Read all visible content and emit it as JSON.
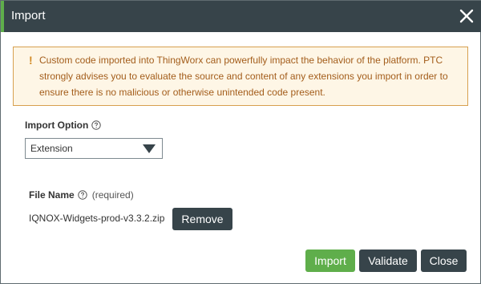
{
  "dialog": {
    "title": "Import",
    "close_icon": "close-x-icon"
  },
  "warning": {
    "icon": "!",
    "text": "Custom code imported into ThingWorx can powerfully impact the behavior of the platform. PTC strongly advises you to evaluate the source and content of any extensions you import in order to ensure there is no malicious or otherwise unintended code present."
  },
  "import_option": {
    "label": "Import Option",
    "selected": "Extension"
  },
  "file_name": {
    "label": "File Name",
    "required": "(required)",
    "value": "IQNOX-Widgets-prod-v3.3.2.zip"
  },
  "buttons": {
    "remove": "Remove",
    "import": "Import",
    "validate": "Validate",
    "close": "Close"
  },
  "colors": {
    "header_bg": "#37444a",
    "accent_green": "#5fae4b",
    "warning_bg": "#fef6e6",
    "warning_border": "#d7a04f",
    "warning_text": "#a35d1b"
  }
}
